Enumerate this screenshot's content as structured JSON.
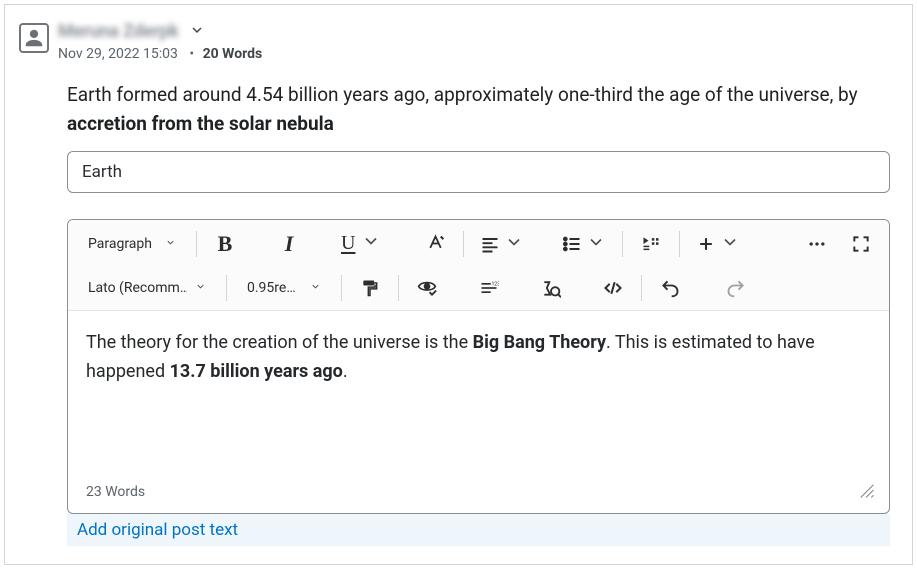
{
  "post": {
    "author_name": "Meruna Zderpk",
    "timestamp": "Nov 29, 2022 15:03",
    "word_count_label": "20 Words",
    "quoted_html_pre": "Earth formed around 4.54 billion years ago, approximately one-third the age of the universe, by ",
    "quoted_html_bold": "accretion from the solar nebula",
    "title_value": "Earth"
  },
  "editor": {
    "block_format": "Paragraph",
    "font_family": "Lato (Recomm…",
    "font_size": "0.95re…",
    "content_pre": "The theory for the creation of the universe is the ",
    "content_bold1": "Big Bang Theory",
    "content_mid": ". This is estimated to have happened ",
    "content_bold2": "13.7 billion years ago",
    "content_post": ".",
    "word_count": "23 Words"
  },
  "actions": {
    "add_original_link": "Add original post text"
  }
}
